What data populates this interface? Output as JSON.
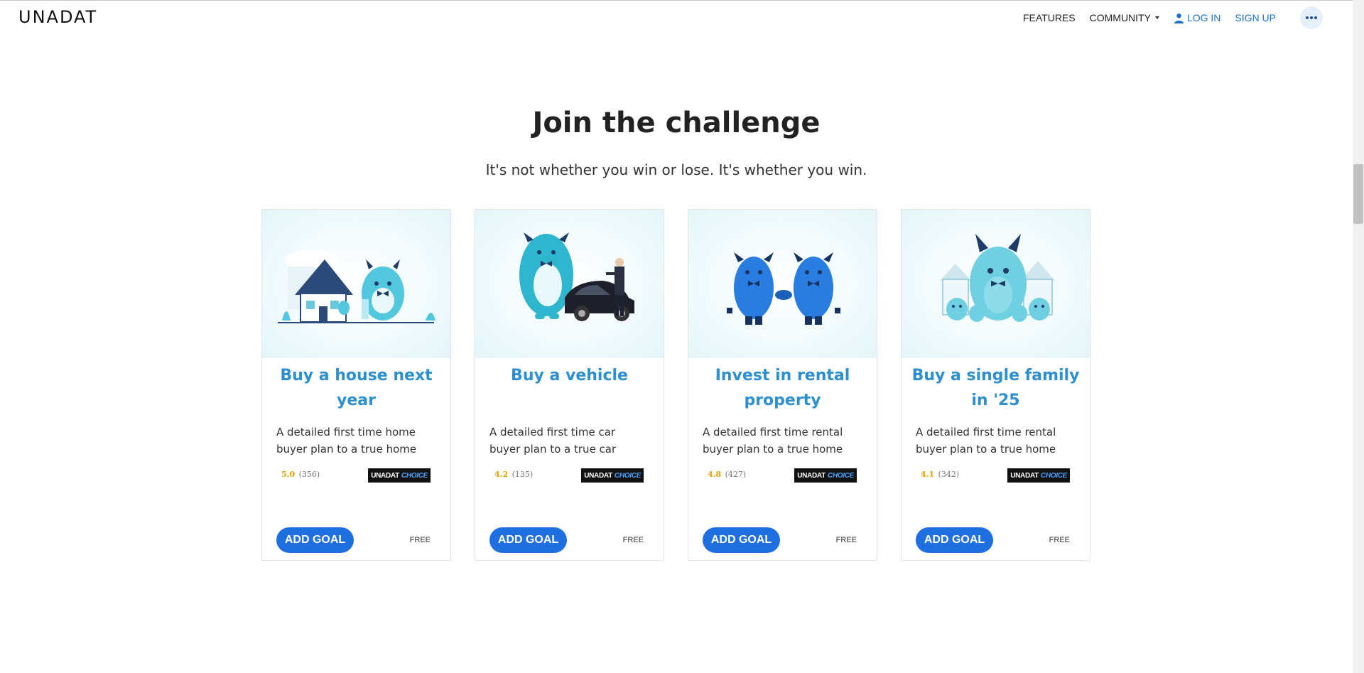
{
  "brand": {
    "logo_text": "UNADAT",
    "badge_brand": "UNADAT",
    "badge_choice": "CHOICE"
  },
  "nav": {
    "features": "FEATURES",
    "community": "COMMUNITY",
    "login": "LOG IN",
    "signup": "SIGN UP"
  },
  "hero": {
    "title": "Join the challenge",
    "subtitle": "It's not whether you win or lose. It's whether you win."
  },
  "cards": [
    {
      "title": "Buy a house next year",
      "description": "A detailed first time home buyer plan to a true home",
      "score": "5.0",
      "count": "(356)",
      "button": "ADD GOAL",
      "price": "FREE",
      "image_icon": "monster-house-illustration"
    },
    {
      "title": "Buy a vehicle",
      "description": "A detailed first time car buyer plan to a true car",
      "score": "4.2",
      "count": "(135)",
      "button": "ADD GOAL",
      "price": "FREE",
      "image_icon": "monster-car-illustration"
    },
    {
      "title": "Invest in rental property",
      "description": "A detailed first time rental buyer plan to a true home",
      "score": "4.8",
      "count": "(427)",
      "button": "ADD GOAL",
      "price": "FREE",
      "image_icon": "monsters-handshake-illustration"
    },
    {
      "title": "Buy a single family in '25",
      "description": "A detailed first time rental buyer plan to a true home",
      "score": "4.1",
      "count": "(342)",
      "button": "ADD GOAL",
      "price": "FREE",
      "image_icon": "monster-family-illustration"
    }
  ],
  "colors": {
    "accent": "#1f6fe0",
    "title_blue": "#2e8fcf",
    "rating": "#e8a000",
    "nav_blue": "#1a73c9"
  }
}
